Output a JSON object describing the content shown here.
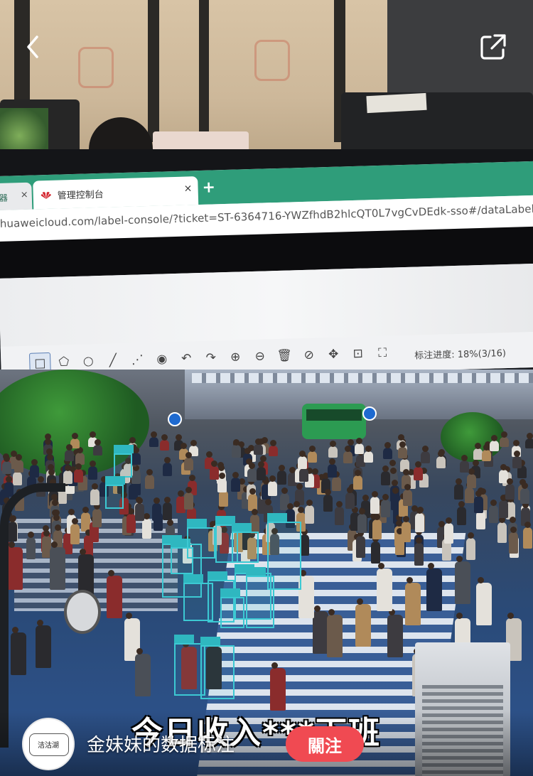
{
  "top_nav": {
    "back_icon": "chevron-left-icon",
    "share_icon": "share-external-icon"
  },
  "browser": {
    "prev_tab_label": "器",
    "prev_tab_close": "×",
    "active_tab_title": "管理控制台",
    "active_tab_close": "×",
    "new_tab": "+",
    "url": "huaweicloud.com/label-console/?ticket=ST-6364716-YWZfhdB2hlcQT0L7vgCvDEdk-sso#/dataLabelAnnotation/g"
  },
  "toolbar": {
    "tools": [
      {
        "name": "rectangle-tool",
        "icon": "square-icon",
        "glyph": "□"
      },
      {
        "name": "polygon-tool",
        "icon": "polygon-icon",
        "glyph": "⬠"
      },
      {
        "name": "circle-tool",
        "icon": "circle-icon",
        "glyph": "○"
      },
      {
        "name": "line-tool",
        "icon": "line-icon",
        "glyph": "╱"
      },
      {
        "name": "dashed-line-tool",
        "icon": "dashed-line-icon",
        "glyph": "⋰"
      },
      {
        "name": "point-tool",
        "icon": "point-icon",
        "glyph": "◉"
      },
      {
        "name": "undo-tool",
        "icon": "undo-icon",
        "glyph": "↶"
      },
      {
        "name": "redo-tool",
        "icon": "redo-icon",
        "glyph": "↷"
      },
      {
        "name": "zoom-in-tool",
        "icon": "zoom-in-icon",
        "glyph": "⊕"
      },
      {
        "name": "zoom-out-tool",
        "icon": "zoom-out-icon",
        "glyph": "⊖"
      },
      {
        "name": "delete-tool",
        "icon": "trash-icon",
        "glyph": "🗑"
      },
      {
        "name": "hide-tool",
        "icon": "eye-off-icon",
        "glyph": "⊘"
      },
      {
        "name": "move-tool",
        "icon": "move-icon",
        "glyph": "✥"
      },
      {
        "name": "fit-tool",
        "icon": "fit-icon",
        "glyph": "⊡"
      },
      {
        "name": "fullscreen-tool",
        "icon": "fullscreen-icon",
        "glyph": "⛶"
      }
    ],
    "progress_text": "标注进度: 18%(3/16)"
  },
  "overlay": {
    "caption": "今日收入***下班",
    "author": "金妹妹的数据标注",
    "follow_label": "關注",
    "avatar_text": "洁沽湖"
  },
  "colors": {
    "tab_green": "#2f9d7a",
    "annotation_cyan": "#3cc9d3",
    "follow_red": "#f04a52"
  }
}
